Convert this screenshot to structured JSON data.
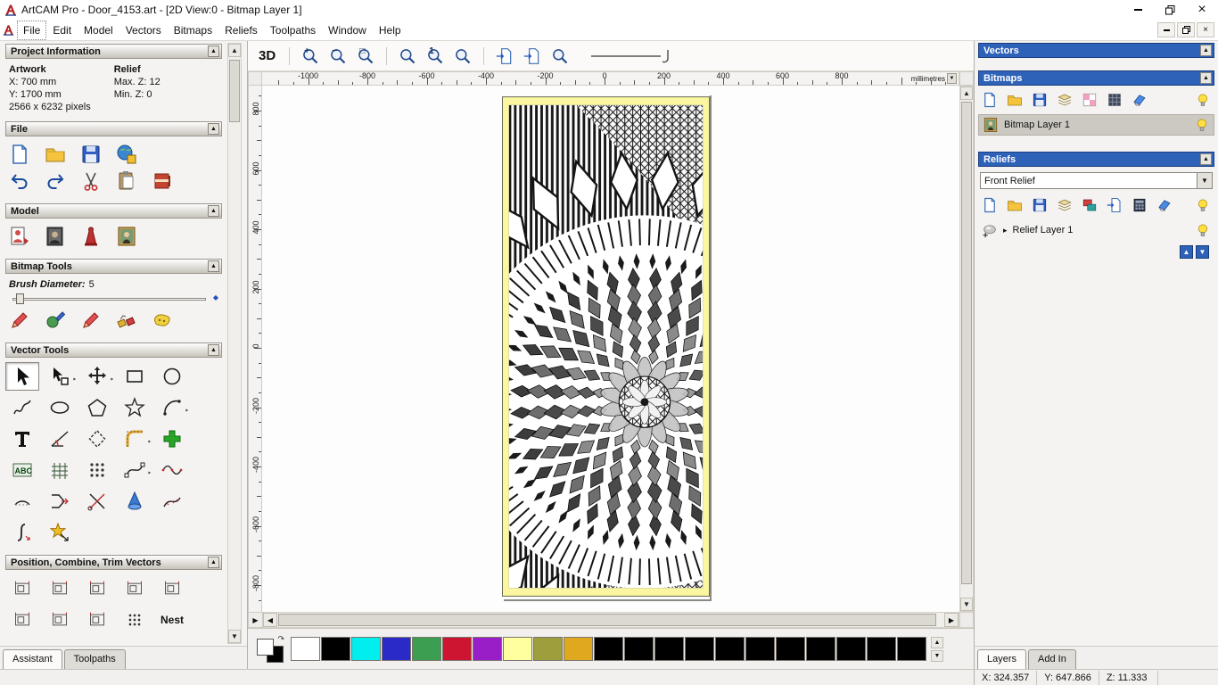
{
  "window": {
    "title": "ArtCAM Pro - Door_4153.art - [2D View:0 - Bitmap Layer 1]"
  },
  "menu": {
    "items": [
      "File",
      "Edit",
      "Model",
      "Vectors",
      "Bitmaps",
      "Reliefs",
      "Toolpaths",
      "Window",
      "Help"
    ]
  },
  "assistant": {
    "project": {
      "title": "Project Information",
      "artwork_label": "Artwork",
      "relief_label": "Relief",
      "rows": {
        "x": "X: 700 mm",
        "y": "Y: 1700 mm",
        "pixels": "2566 x 6232 pixels",
        "max_z": "Max. Z: 12",
        "min_z": "Min. Z: 0"
      }
    },
    "file_title": "File",
    "model_title": "Model",
    "bitmap_tools_title": "Bitmap Tools",
    "brush_diameter_label": "Brush Diameter:",
    "brush_diameter_value": "5",
    "vector_tools_title": "Vector Tools",
    "position_title": "Position, Combine, Trim Vectors",
    "nest_label": "Nest",
    "tabs": {
      "assistant": "Assistant",
      "toolpaths": "Toolpaths"
    }
  },
  "view": {
    "mode_3d": "3D",
    "units": "millimetres",
    "ruler_h": [
      -1000,
      -800,
      -600,
      -400,
      -200,
      0,
      200,
      400,
      600,
      800
    ],
    "ruler_v": [
      800,
      600,
      400,
      200,
      0,
      -200,
      -400,
      -600,
      -800
    ]
  },
  "palette": {
    "primary": "#ffffff",
    "secondary": "#000000",
    "colors": [
      "#ffffff",
      "#000000",
      "#00eeee",
      "#2a2ac8",
      "#3c9e50",
      "#cd1430",
      "#9a1ec8",
      "#ffffa0",
      "#9e9e3c",
      "#e0a81e",
      "#000000",
      "#000000",
      "#000000",
      "#000000",
      "#000000",
      "#000000",
      "#000000",
      "#000000",
      "#000000",
      "#000000",
      "#000000"
    ]
  },
  "panels": {
    "vectors": {
      "title": "Vectors"
    },
    "bitmaps": {
      "title": "Bitmaps",
      "layer": "Bitmap Layer 1"
    },
    "reliefs": {
      "title": "Reliefs",
      "selected": "Front Relief",
      "layer": "Relief Layer 1"
    },
    "tabs": {
      "layers": "Layers",
      "addin": "Add In"
    }
  },
  "status": {
    "x": "X: 324.357",
    "y": "Y: 647.866",
    "z": "Z: 11.333"
  },
  "glyphs": {
    "collapse": "▲",
    "dropdown": "▼",
    "up": "▲",
    "down": "▼",
    "left": "◀",
    "right": "▶",
    "expand": "▸",
    "close": "×",
    "zoom_in": "+",
    "zoom_out": "−",
    "zoom_window": "□",
    "zoom_one": "1",
    "swap": "↷"
  }
}
